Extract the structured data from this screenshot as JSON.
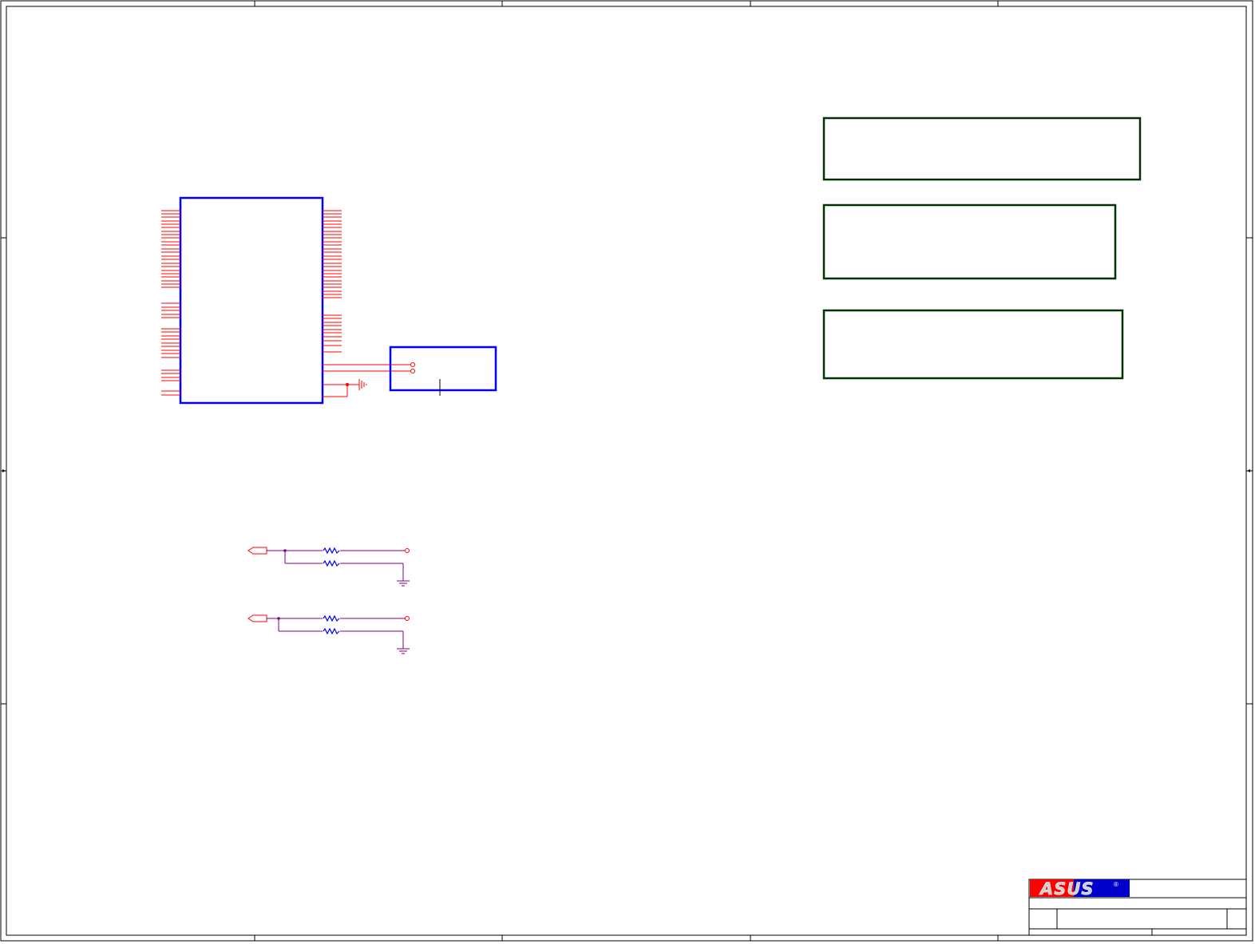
{
  "sheet": {
    "title_block": {
      "logo": {
        "text": "ASUS",
        "registered_mark": "®"
      }
    }
  },
  "colors": {
    "frame": "#000000",
    "component_body": "#0000ff",
    "pin_wire": "#ff0000",
    "net_wire": "#800080",
    "resistor": "#0000ff",
    "note_box": "#003300",
    "logo_red": "#ff0000",
    "logo_blue": "#0000cc",
    "logo_letters": "#c0c0c0"
  },
  "icons": {
    "ground": "ground-symbol-icon",
    "resistor": "resistor-icon",
    "port": "offpage-connector-icon",
    "test_point": "test-point-icon"
  }
}
